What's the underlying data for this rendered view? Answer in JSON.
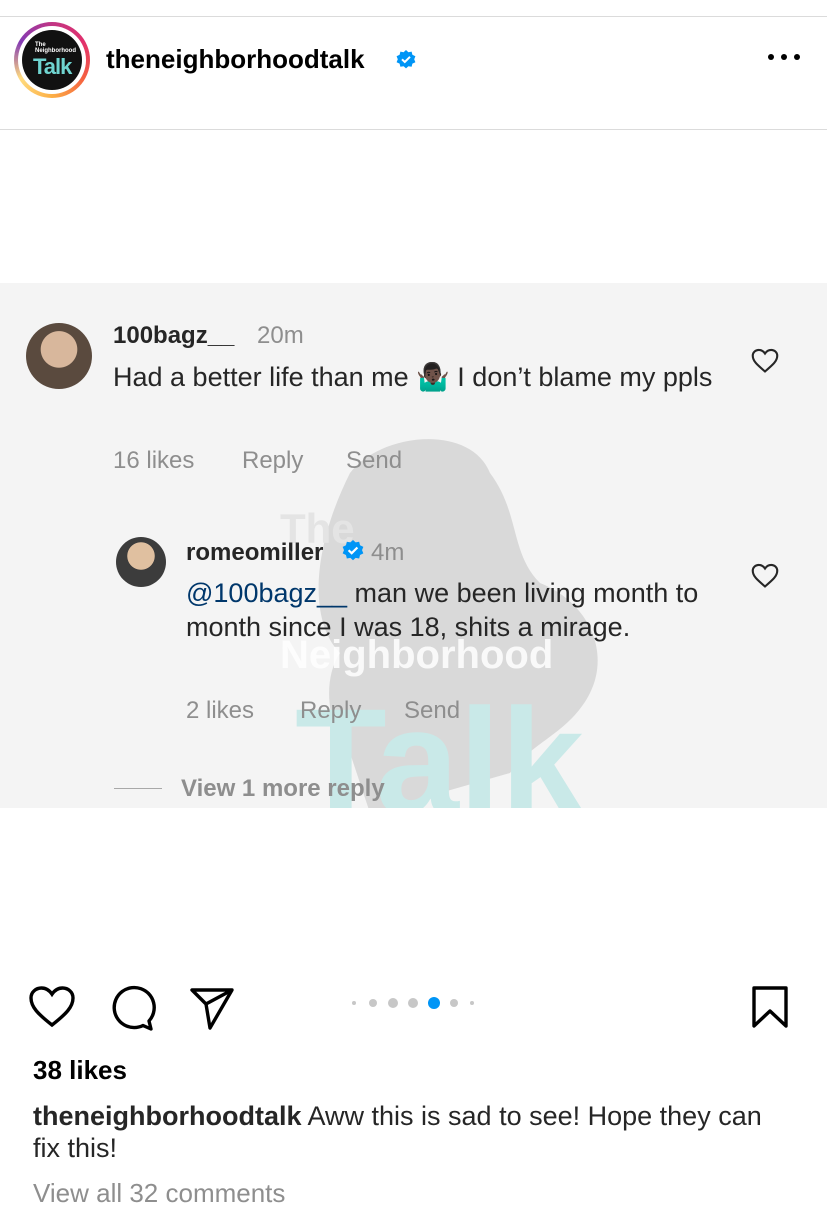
{
  "header": {
    "account": "theneighborhoodtalk",
    "logo_small": "The Neighborhood",
    "logo_big": "Talk"
  },
  "comments": [
    {
      "username": "100bagz__",
      "time": "20m",
      "text_before_emoji": "Had a better life than me ",
      "emoji": "🤷🏿‍♂️",
      "text_after_emoji": " I don’t blame my ppls",
      "likes": "16 likes",
      "reply": "Reply",
      "send": "Send"
    },
    {
      "username": "romeomiller",
      "time": "4m",
      "mention": "@100bagz__",
      "text": " man we been living month to month since I was 18, shits a mirage.",
      "likes": "2 likes",
      "reply": "Reply",
      "send": "Send"
    }
  ],
  "view_more": "View 1 more reply",
  "watermark": {
    "line1": "The",
    "line2": "Neighborhood",
    "line3": "Talk"
  },
  "post": {
    "likes": "38 likes",
    "caption_user": "theneighborhoodtalk",
    "caption_text": " Aww this is sad to see! Hope they can fix this!",
    "view_all": "View all 32 comments"
  },
  "carousel": {
    "count": 6,
    "active_index": 4
  },
  "colors": {
    "verified": "#0095f6",
    "active_dot": "#0095f6",
    "mention": "#00376b"
  }
}
